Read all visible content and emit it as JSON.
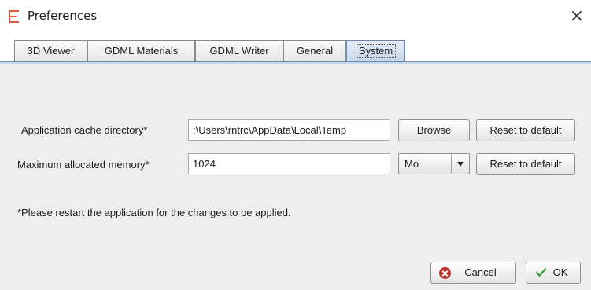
{
  "window": {
    "title": "Preferences",
    "close_glyph": "×"
  },
  "tabs": [
    {
      "label": "3D Viewer",
      "active": false
    },
    {
      "label": "GDML Materials",
      "active": false
    },
    {
      "label": "GDML Writer",
      "active": false
    },
    {
      "label": "General",
      "active": false
    },
    {
      "label": "System",
      "active": true
    }
  ],
  "system": {
    "cache_dir_label": "Application cache directory*",
    "cache_dir_value": ":\\Users\\rntrc\\AppData\\Local\\Temp",
    "browse_label": "Browse",
    "reset_label": "Reset to default",
    "memory_label": "Maximum allocated memory*",
    "memory_value": "1024",
    "memory_unit": "Mo",
    "note": "*Please restart the application for the changes to be applied."
  },
  "footer": {
    "cancel_label": "Cancel",
    "ok_label": "OK",
    "cancel_icon": "cancel-icon",
    "ok_icon": "checkmark-icon"
  },
  "colors": {
    "accent_orange": "#e05a3a",
    "tab_active": "#c7d8ec",
    "cancel_red": "#c2332a",
    "ok_green": "#3a9a3a"
  }
}
